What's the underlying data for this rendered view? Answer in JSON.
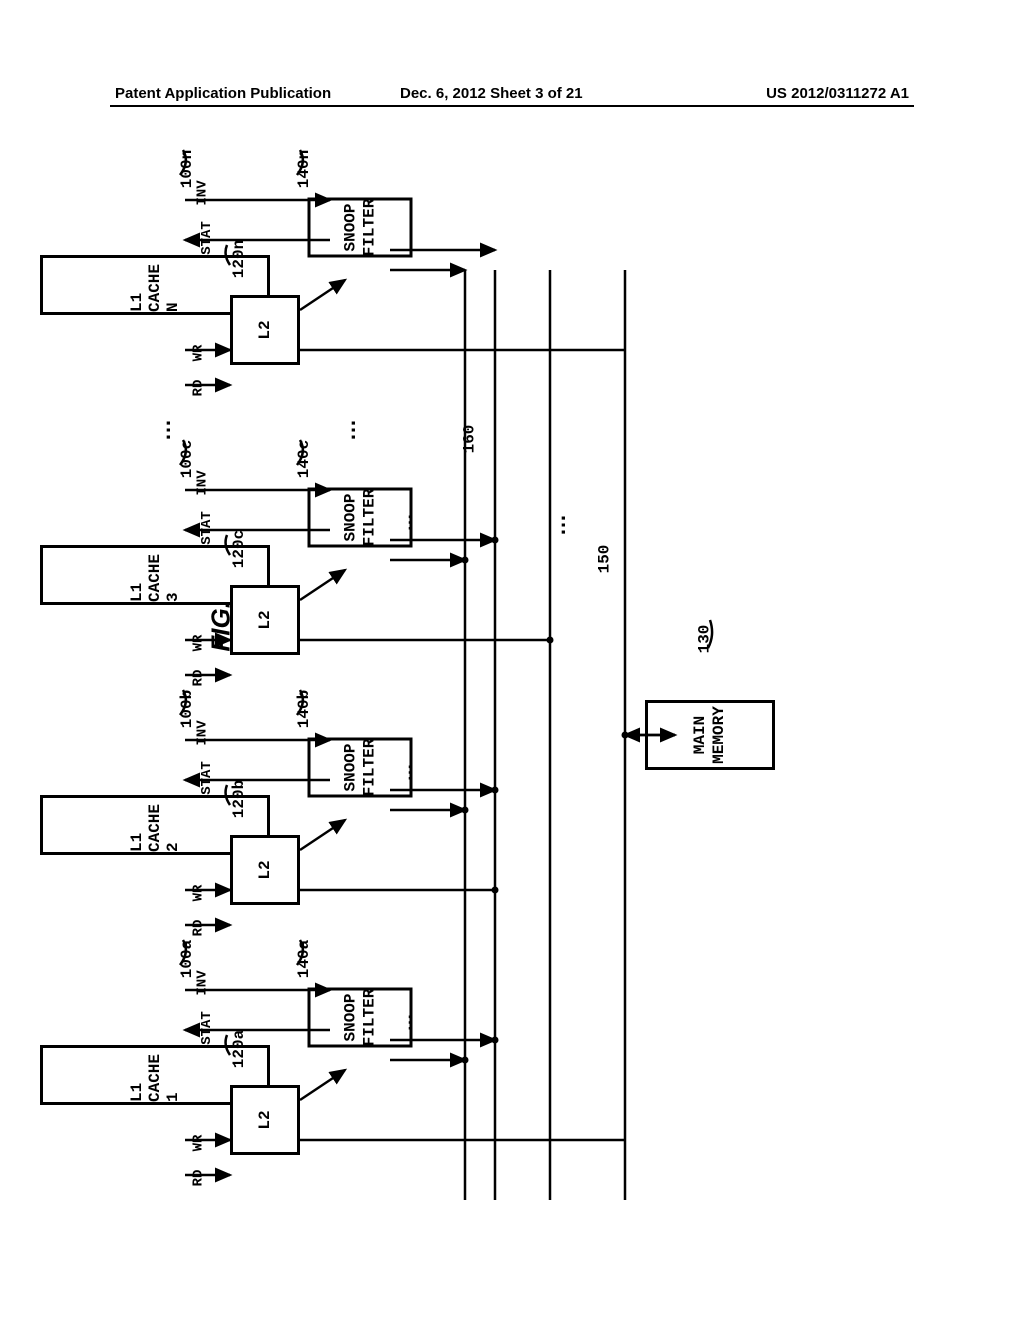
{
  "header": {
    "left": "Patent Application Publication",
    "center": "Dec. 6, 2012  Sheet 3 of 21",
    "right": "US 2012/0311272 A1"
  },
  "figure": {
    "title": "FIG. 3",
    "main_memory": "MAIN\nMEMORY",
    "ref_main_memory": "130",
    "bus_ref_1": "150",
    "bus_ref_2": "160",
    "ellipsis": "…",
    "blocks": [
      {
        "id": "a",
        "l1": "L1 CACHE 1",
        "l2": "L2",
        "snoop": "SNOOP\nFILTER",
        "ref_l1": "100a",
        "ref_l2": "120a",
        "ref_sf": "140a",
        "rd": "RD",
        "wr": "WR",
        "stat": "STAT",
        "inv": "INV"
      },
      {
        "id": "b",
        "l1": "L1 CACHE 2",
        "l2": "L2",
        "snoop": "SNOOP\nFILTER",
        "ref_l1": "100b",
        "ref_l2": "120b",
        "ref_sf": "140b",
        "rd": "RD",
        "wr": "WR",
        "stat": "STAT",
        "inv": "INV"
      },
      {
        "id": "c",
        "l1": "L1 CACHE 3",
        "l2": "L2",
        "snoop": "SNOOP\nFILTER",
        "ref_l1": "100c",
        "ref_l2": "120c",
        "ref_sf": "140c",
        "rd": "RD",
        "wr": "WR",
        "stat": "STAT",
        "inv": "INV"
      },
      {
        "id": "n",
        "l1": "L1 CACHE N",
        "l2": "L2",
        "snoop": "SNOOP\nFILTER",
        "ref_l1": "100n",
        "ref_l2": "120n",
        "ref_sf": "140n",
        "rd": "RD",
        "wr": "WR",
        "stat": "STAT",
        "inv": "INV"
      }
    ]
  }
}
